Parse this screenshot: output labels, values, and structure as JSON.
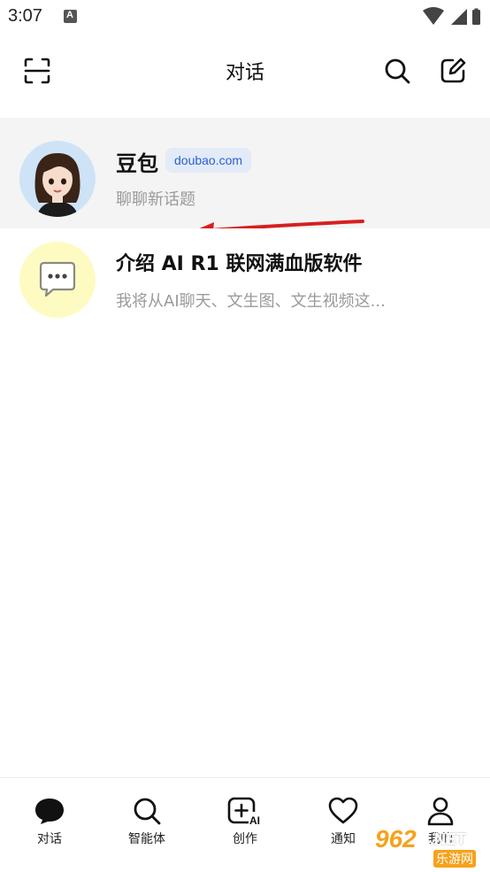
{
  "status_bar": {
    "time": "3:07",
    "a_badge": "A"
  },
  "header": {
    "title": "对话"
  },
  "conversations": [
    {
      "name": "豆包",
      "badge": "doubao.com",
      "preview": "聊聊新话题",
      "avatar": "doubao-avatar"
    },
    {
      "name": "介绍 AI R1 联网满血版软件",
      "preview": "我将从AI聊天、文生图、文生视频这...",
      "avatar": "chat-bubble-icon"
    }
  ],
  "tabs": [
    {
      "label": "对话",
      "icon": "chat-icon"
    },
    {
      "label": "智能体",
      "icon": "search-icon"
    },
    {
      "label": "创作",
      "icon": "create-ai-icon"
    },
    {
      "label": "通知",
      "icon": "heart-icon"
    },
    {
      "label": "我的",
      "icon": "user-icon"
    }
  ],
  "watermark": {
    "top": "962",
    "net": ".NET",
    "bottom": "乐游网"
  },
  "colors": {
    "accent": "#2b5fd0",
    "badge_bg": "#e3ebf8",
    "annotation_arrow": "#d61f1f",
    "watermark": "#f6a21c"
  }
}
